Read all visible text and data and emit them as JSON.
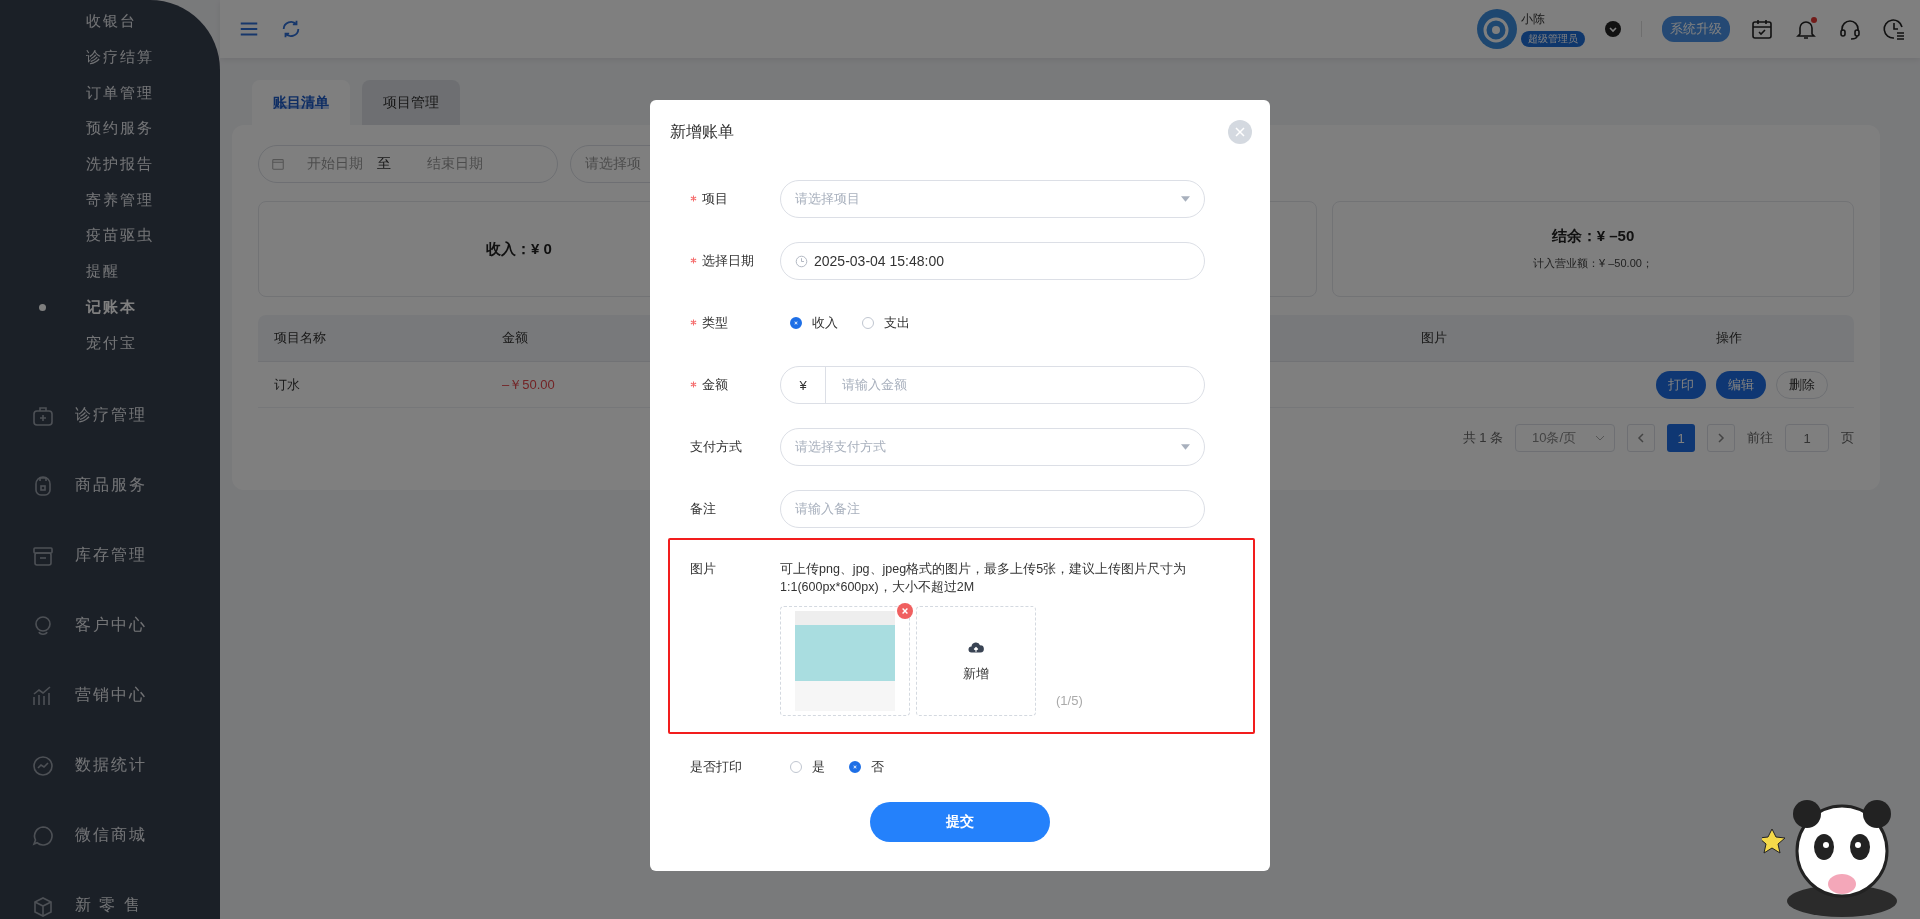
{
  "sidebar": {
    "sub_items": [
      {
        "label": "收银台",
        "selected": false
      },
      {
        "label": "诊疗结算",
        "selected": false
      },
      {
        "label": "订单管理",
        "selected": false
      },
      {
        "label": "预约服务",
        "selected": false
      },
      {
        "label": "洗护报告",
        "selected": false
      },
      {
        "label": "寄养管理",
        "selected": false
      },
      {
        "label": "疫苗驱虫",
        "selected": false
      },
      {
        "label": "提醒",
        "selected": false
      },
      {
        "label": "记账本",
        "selected": true
      },
      {
        "label": "宠付宝",
        "selected": false
      }
    ],
    "items": [
      {
        "label": "诊疗管理"
      },
      {
        "label": "商品服务"
      },
      {
        "label": "库存管理"
      },
      {
        "label": "客户中心"
      },
      {
        "label": "营销中心"
      },
      {
        "label": "数据统计"
      },
      {
        "label": "微信商城"
      },
      {
        "label": "新 零 售"
      }
    ]
  },
  "topbar": {
    "user_name": "小陈",
    "role_badge": "超级管理员",
    "upgrade_button": "系统升级",
    "notification": true
  },
  "tabs": [
    {
      "label": "账目清单",
      "selected": true
    },
    {
      "label": "项目管理",
      "selected": false
    }
  ],
  "filters": {
    "start_placeholder": "开始日期",
    "separator": "至",
    "end_placeholder": "结束日期",
    "project_placeholder": "请选择项"
  },
  "stats": [
    {
      "title": "收入：",
      "value": "¥ 0"
    },
    {
      "title": "结余：",
      "value": "¥ –50",
      "note": "计入营业额：¥ –50.00；"
    }
  ],
  "table": {
    "columns": [
      "项目名称",
      "金额",
      "图片",
      "操作"
    ],
    "rows": [
      {
        "name": "订水",
        "amount": "–￥50.00",
        "actions": [
          {
            "label": "打印",
            "kind": "primary"
          },
          {
            "label": "编辑",
            "kind": "primary"
          },
          {
            "label": "删除",
            "kind": "default"
          }
        ]
      }
    ]
  },
  "pagination": {
    "total": "共 1 条",
    "page_size": "10条/页",
    "pages": [
      {
        "label": "1",
        "selected": true
      }
    ],
    "goto_label": "前往",
    "goto_value": "1",
    "page_suffix": "页"
  },
  "dialog": {
    "title": "新增账单",
    "submit": "提交",
    "fields": [
      {
        "kind": "select",
        "label": "项目",
        "required": true,
        "placeholder": "请选择项目"
      },
      {
        "kind": "datetime",
        "label": "选择日期",
        "required": true,
        "value": "2025-03-04 15:48:00"
      },
      {
        "kind": "radio",
        "label": "类型",
        "required": true,
        "options": [
          {
            "label": "收入",
            "selected": true
          },
          {
            "label": "支出",
            "selected": false
          }
        ]
      },
      {
        "kind": "amount",
        "label": "金额",
        "required": true,
        "prefix": "¥",
        "placeholder": "请输入金额"
      },
      {
        "kind": "select",
        "label": "支付方式",
        "required": false,
        "placeholder": "请选择支付方式"
      },
      {
        "kind": "text",
        "label": "备注",
        "required": false,
        "placeholder": "请输入备注"
      },
      {
        "kind": "upload",
        "label": "图片",
        "required": false,
        "highlighted": true,
        "hint": "可上传png、jpg、jpeg格式的图片，最多上传5张，建议上传图片尺寸为1:1(600px*600px)，大小不超过2M",
        "images": [
          {
            "removable": true
          }
        ],
        "add_label": "新增",
        "count": "(1/5)"
      },
      {
        "kind": "radio",
        "label": "是否打印",
        "required": false,
        "options": [
          {
            "label": "是",
            "selected": false
          },
          {
            "label": "否",
            "selected": true
          }
        ]
      }
    ]
  }
}
